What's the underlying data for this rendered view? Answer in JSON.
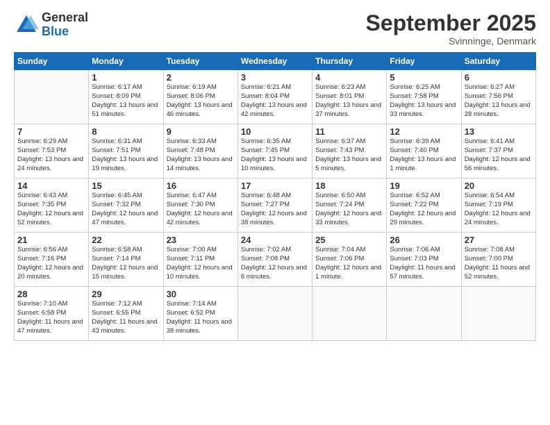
{
  "logo": {
    "general": "General",
    "blue": "Blue"
  },
  "title": "September 2025",
  "subtitle": "Svinninge, Denmark",
  "days_header": [
    "Sunday",
    "Monday",
    "Tuesday",
    "Wednesday",
    "Thursday",
    "Friday",
    "Saturday"
  ],
  "weeks": [
    [
      {
        "day": "",
        "sunrise": "",
        "sunset": "",
        "daylight": ""
      },
      {
        "day": "1",
        "sunrise": "Sunrise: 6:17 AM",
        "sunset": "Sunset: 8:09 PM",
        "daylight": "Daylight: 13 hours and 51 minutes."
      },
      {
        "day": "2",
        "sunrise": "Sunrise: 6:19 AM",
        "sunset": "Sunset: 8:06 PM",
        "daylight": "Daylight: 13 hours and 46 minutes."
      },
      {
        "day": "3",
        "sunrise": "Sunrise: 6:21 AM",
        "sunset": "Sunset: 8:04 PM",
        "daylight": "Daylight: 13 hours and 42 minutes."
      },
      {
        "day": "4",
        "sunrise": "Sunrise: 6:23 AM",
        "sunset": "Sunset: 8:01 PM",
        "daylight": "Daylight: 13 hours and 37 minutes."
      },
      {
        "day": "5",
        "sunrise": "Sunrise: 6:25 AM",
        "sunset": "Sunset: 7:58 PM",
        "daylight": "Daylight: 13 hours and 33 minutes."
      },
      {
        "day": "6",
        "sunrise": "Sunrise: 6:27 AM",
        "sunset": "Sunset: 7:56 PM",
        "daylight": "Daylight: 13 hours and 28 minutes."
      }
    ],
    [
      {
        "day": "7",
        "sunrise": "Sunrise: 6:29 AM",
        "sunset": "Sunset: 7:53 PM",
        "daylight": "Daylight: 13 hours and 24 minutes."
      },
      {
        "day": "8",
        "sunrise": "Sunrise: 6:31 AM",
        "sunset": "Sunset: 7:51 PM",
        "daylight": "Daylight: 13 hours and 19 minutes."
      },
      {
        "day": "9",
        "sunrise": "Sunrise: 6:33 AM",
        "sunset": "Sunset: 7:48 PM",
        "daylight": "Daylight: 13 hours and 14 minutes."
      },
      {
        "day": "10",
        "sunrise": "Sunrise: 6:35 AM",
        "sunset": "Sunset: 7:45 PM",
        "daylight": "Daylight: 13 hours and 10 minutes."
      },
      {
        "day": "11",
        "sunrise": "Sunrise: 6:37 AM",
        "sunset": "Sunset: 7:43 PM",
        "daylight": "Daylight: 13 hours and 5 minutes."
      },
      {
        "day": "12",
        "sunrise": "Sunrise: 6:39 AM",
        "sunset": "Sunset: 7:40 PM",
        "daylight": "Daylight: 13 hours and 1 minute."
      },
      {
        "day": "13",
        "sunrise": "Sunrise: 6:41 AM",
        "sunset": "Sunset: 7:37 PM",
        "daylight": "Daylight: 12 hours and 56 minutes."
      }
    ],
    [
      {
        "day": "14",
        "sunrise": "Sunrise: 6:43 AM",
        "sunset": "Sunset: 7:35 PM",
        "daylight": "Daylight: 12 hours and 52 minutes."
      },
      {
        "day": "15",
        "sunrise": "Sunrise: 6:45 AM",
        "sunset": "Sunset: 7:32 PM",
        "daylight": "Daylight: 12 hours and 47 minutes."
      },
      {
        "day": "16",
        "sunrise": "Sunrise: 6:47 AM",
        "sunset": "Sunset: 7:30 PM",
        "daylight": "Daylight: 12 hours and 42 minutes."
      },
      {
        "day": "17",
        "sunrise": "Sunrise: 6:48 AM",
        "sunset": "Sunset: 7:27 PM",
        "daylight": "Daylight: 12 hours and 38 minutes."
      },
      {
        "day": "18",
        "sunrise": "Sunrise: 6:50 AM",
        "sunset": "Sunset: 7:24 PM",
        "daylight": "Daylight: 12 hours and 33 minutes."
      },
      {
        "day": "19",
        "sunrise": "Sunrise: 6:52 AM",
        "sunset": "Sunset: 7:22 PM",
        "daylight": "Daylight: 12 hours and 29 minutes."
      },
      {
        "day": "20",
        "sunrise": "Sunrise: 6:54 AM",
        "sunset": "Sunset: 7:19 PM",
        "daylight": "Daylight: 12 hours and 24 minutes."
      }
    ],
    [
      {
        "day": "21",
        "sunrise": "Sunrise: 6:56 AM",
        "sunset": "Sunset: 7:16 PM",
        "daylight": "Daylight: 12 hours and 20 minutes."
      },
      {
        "day": "22",
        "sunrise": "Sunrise: 6:58 AM",
        "sunset": "Sunset: 7:14 PM",
        "daylight": "Daylight: 12 hours and 15 minutes."
      },
      {
        "day": "23",
        "sunrise": "Sunrise: 7:00 AM",
        "sunset": "Sunset: 7:11 PM",
        "daylight": "Daylight: 12 hours and 10 minutes."
      },
      {
        "day": "24",
        "sunrise": "Sunrise: 7:02 AM",
        "sunset": "Sunset: 7:08 PM",
        "daylight": "Daylight: 12 hours and 6 minutes."
      },
      {
        "day": "25",
        "sunrise": "Sunrise: 7:04 AM",
        "sunset": "Sunset: 7:06 PM",
        "daylight": "Daylight: 12 hours and 1 minute."
      },
      {
        "day": "26",
        "sunrise": "Sunrise: 7:06 AM",
        "sunset": "Sunset: 7:03 PM",
        "daylight": "Daylight: 11 hours and 57 minutes."
      },
      {
        "day": "27",
        "sunrise": "Sunrise: 7:08 AM",
        "sunset": "Sunset: 7:00 PM",
        "daylight": "Daylight: 11 hours and 52 minutes."
      }
    ],
    [
      {
        "day": "28",
        "sunrise": "Sunrise: 7:10 AM",
        "sunset": "Sunset: 6:58 PM",
        "daylight": "Daylight: 11 hours and 47 minutes."
      },
      {
        "day": "29",
        "sunrise": "Sunrise: 7:12 AM",
        "sunset": "Sunset: 6:55 PM",
        "daylight": "Daylight: 11 hours and 43 minutes."
      },
      {
        "day": "30",
        "sunrise": "Sunrise: 7:14 AM",
        "sunset": "Sunset: 6:52 PM",
        "daylight": "Daylight: 11 hours and 38 minutes."
      },
      {
        "day": "",
        "sunrise": "",
        "sunset": "",
        "daylight": ""
      },
      {
        "day": "",
        "sunrise": "",
        "sunset": "",
        "daylight": ""
      },
      {
        "day": "",
        "sunrise": "",
        "sunset": "",
        "daylight": ""
      },
      {
        "day": "",
        "sunrise": "",
        "sunset": "",
        "daylight": ""
      }
    ]
  ]
}
